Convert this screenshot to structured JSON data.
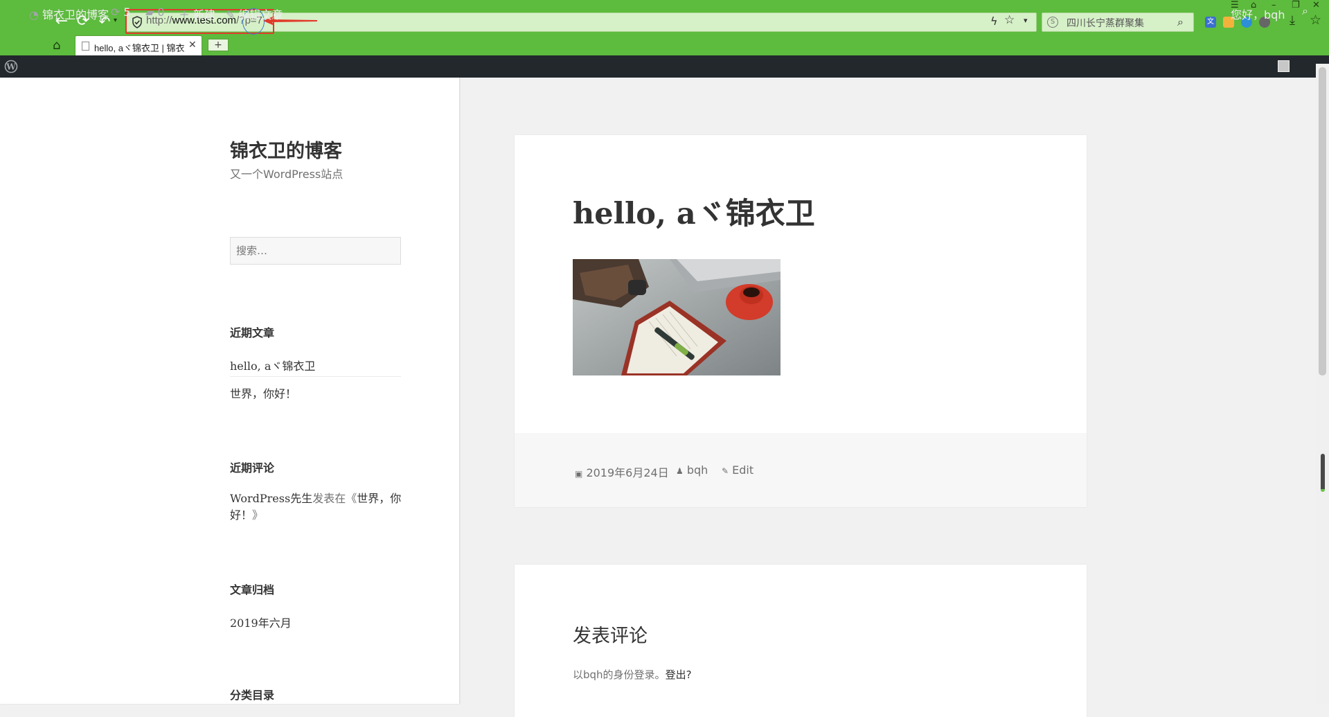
{
  "browser": {
    "url_scheme": "http://",
    "url_host": "www.test.com",
    "url_query": "/?p=7",
    "search_text": "四川长宁蒸群聚集",
    "tab_title": "hello, aヾ锦衣卫 | 锦衣卫的博客",
    "tab_close": "✕",
    "new_tab": "+"
  },
  "adminbar": {
    "site_name": "锦衣卫的博客",
    "updates_count": "5",
    "comments_count": "0",
    "new_label": "新建",
    "edit_label": "编辑文章",
    "greeting": "您好，bqh"
  },
  "sidebar": {
    "site_title": "锦衣卫的博客",
    "site_description": "又一个WordPress站点",
    "search_placeholder": "搜索…",
    "recent_posts_title": "近期文章",
    "recent_posts": [
      "hello, aヾ锦衣卫",
      "世界，你好！"
    ],
    "recent_comments_title": "近期评论",
    "comment_author": "WordPress先生",
    "comment_on": "发表在《",
    "comment_post": "世界，你好！",
    "comment_end": "》",
    "archives_title": "文章归档",
    "archive_item": "2019年六月",
    "categories_title": "分类目录"
  },
  "post": {
    "title": "hello, aヾ锦衣卫",
    "date": "2019年6月24日",
    "author": "bqh",
    "edit": "Edit"
  },
  "comments": {
    "title": "发表评论",
    "logged_in_prefix": "以bqh的身份登录。",
    "logout": "登出?"
  },
  "colors": {
    "browser_green": "#5dbb3e",
    "adminbar": "#23282d",
    "highlight_red": "#e23a2a"
  }
}
